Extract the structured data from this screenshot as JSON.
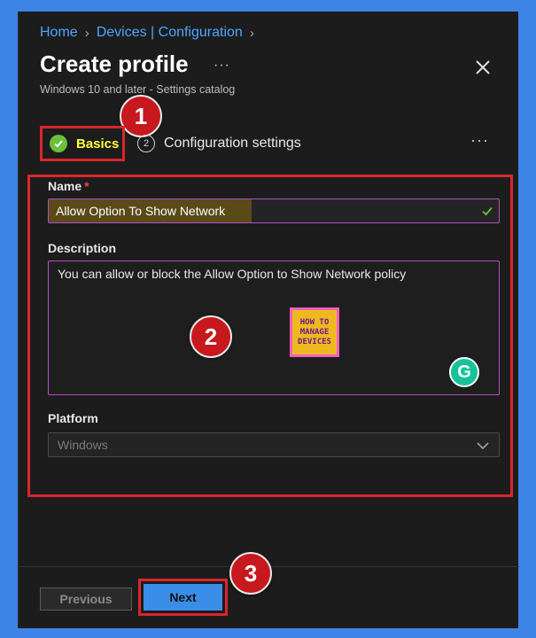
{
  "breadcrumb": {
    "home": "Home",
    "section": "Devices | Configuration"
  },
  "header": {
    "title": "Create profile",
    "more": "···",
    "subtitle": "Windows 10 and later - Settings catalog"
  },
  "tabs": {
    "basics": "Basics",
    "config_step": "2",
    "config": "Configuration settings",
    "more": "···"
  },
  "form": {
    "name_label": "Name",
    "required_mark": "*",
    "name_value": "Allow Option To Show Network",
    "description_label": "Description",
    "description_value": "You can allow or block the Allow Option to Show Network  policy",
    "platform_label": "Platform",
    "platform_value": "Windows"
  },
  "logo": {
    "line1": "HOW TO",
    "line2": "MANAGE",
    "line3": "DEVICES"
  },
  "grammarly": "G",
  "buttons": {
    "previous": "Previous",
    "next": "Next"
  },
  "badges": {
    "one": "1",
    "two": "2",
    "three": "3"
  },
  "colors": {
    "accent": "#3a8ee8",
    "highlight": "#d8262b",
    "background": "#3d84e6"
  }
}
